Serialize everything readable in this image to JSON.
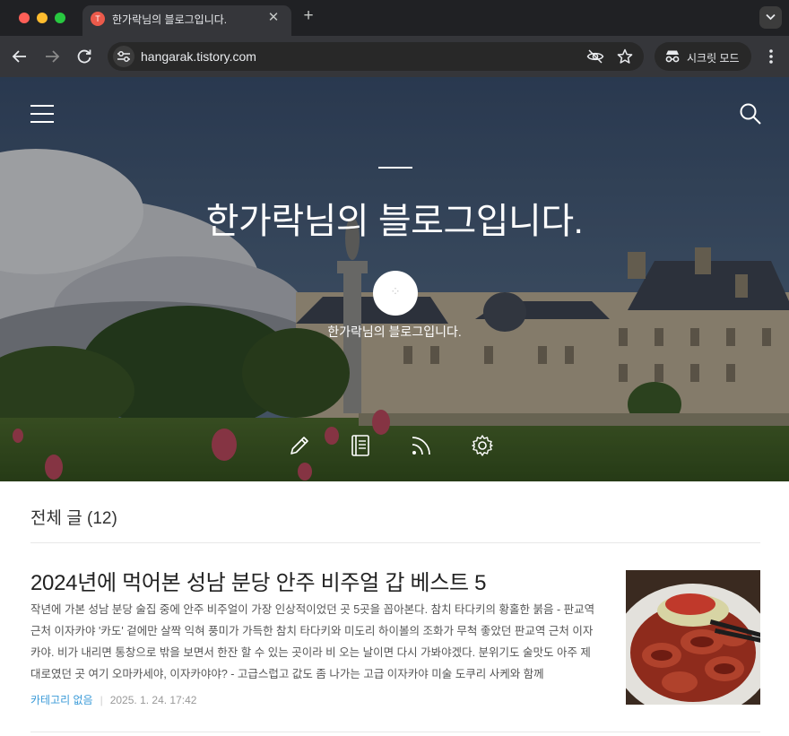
{
  "browser": {
    "tab_title": "한가락님의 블로그입니다.",
    "tab_favicon": "tistory-favicon",
    "url": "hangarak.tistory.com",
    "incognito_label": "시크릿 모드"
  },
  "hero": {
    "title": "한가락님의 블로그입니다.",
    "subtitle": "한가락님의 블로그입니다."
  },
  "section": {
    "title": "전체 글 (12)"
  },
  "post": {
    "title": "2024년에 먹어본 성남 분당 안주 비주얼 갑 베스트 5",
    "excerpt": "작년에 가본 성남 분당 술집 중에 안주 비주얼이 가장 인상적이었던 곳 5곳을 꼽아본다. 참치 타다키의 황홀한 붉음 - 판교역 근처 이자카야 '카도'    겉에만 살짝 익혀 풍미가 가득한 참치 타다키와 미도리 하이볼의 조화가 무척 좋았던 판교역 근처 이자카야. 비가 내리면 통창으로 밖을 보면서 한잔 할 수 있는 곳이라 비 오는 날이면 다시 가봐야겠다. 분위기도 술맛도 아주 제대로였던 곳  여기 오마카세야, 이자카야야? - 고급스럽고 값도 좀 나가는 고급 이자카야 미술   도쿠리 사케와 함께",
    "category": "카테고리 없음",
    "date": "2025. 1. 24. 17:42"
  },
  "colors": {
    "chrome_dark": "#202124",
    "toolbar": "#35363a",
    "category_link": "#3b9bd8",
    "favicon": "#eb5a4b"
  }
}
